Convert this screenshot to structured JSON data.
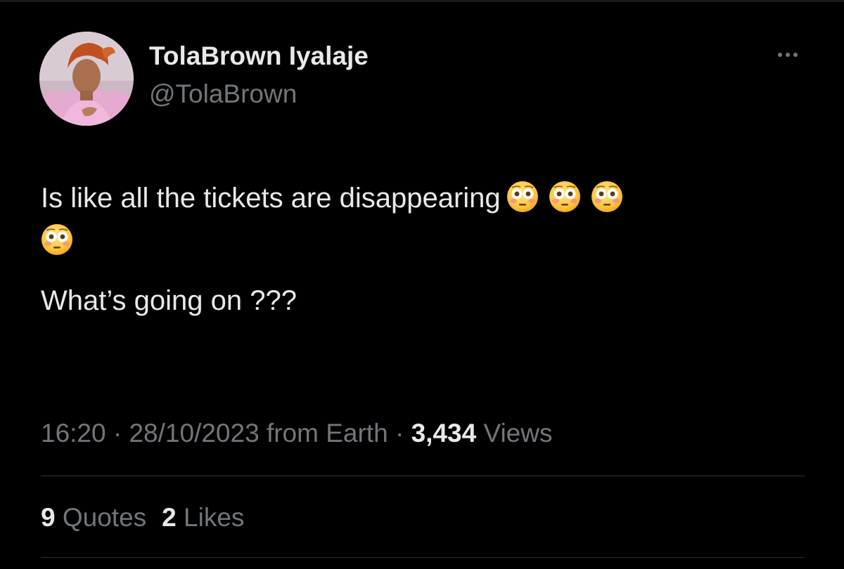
{
  "tweet": {
    "author": {
      "display_name": "TolaBrown Iyalaje",
      "handle": "@TolaBrown"
    },
    "text": {
      "line1": "Is like all the tickets are disappearing",
      "line3": "What’s going on ???"
    },
    "emoji_name": "flushed-face-emoji",
    "emoji_count": 4,
    "meta": {
      "time": "16:20",
      "separator": "·",
      "date": "28/10/2023",
      "source": "from Earth",
      "views_count": "3,434",
      "views_label": "Views"
    },
    "stats": {
      "quotes_count": "9",
      "quotes_label": "Quotes",
      "likes_count": "2",
      "likes_label": "Likes"
    }
  },
  "colors": {
    "background": "#000000",
    "primary_text": "#e7e9ea",
    "secondary_text": "#71767b",
    "divider": "#2f3336"
  },
  "icons": {
    "more": "more-horizontal-icon"
  }
}
